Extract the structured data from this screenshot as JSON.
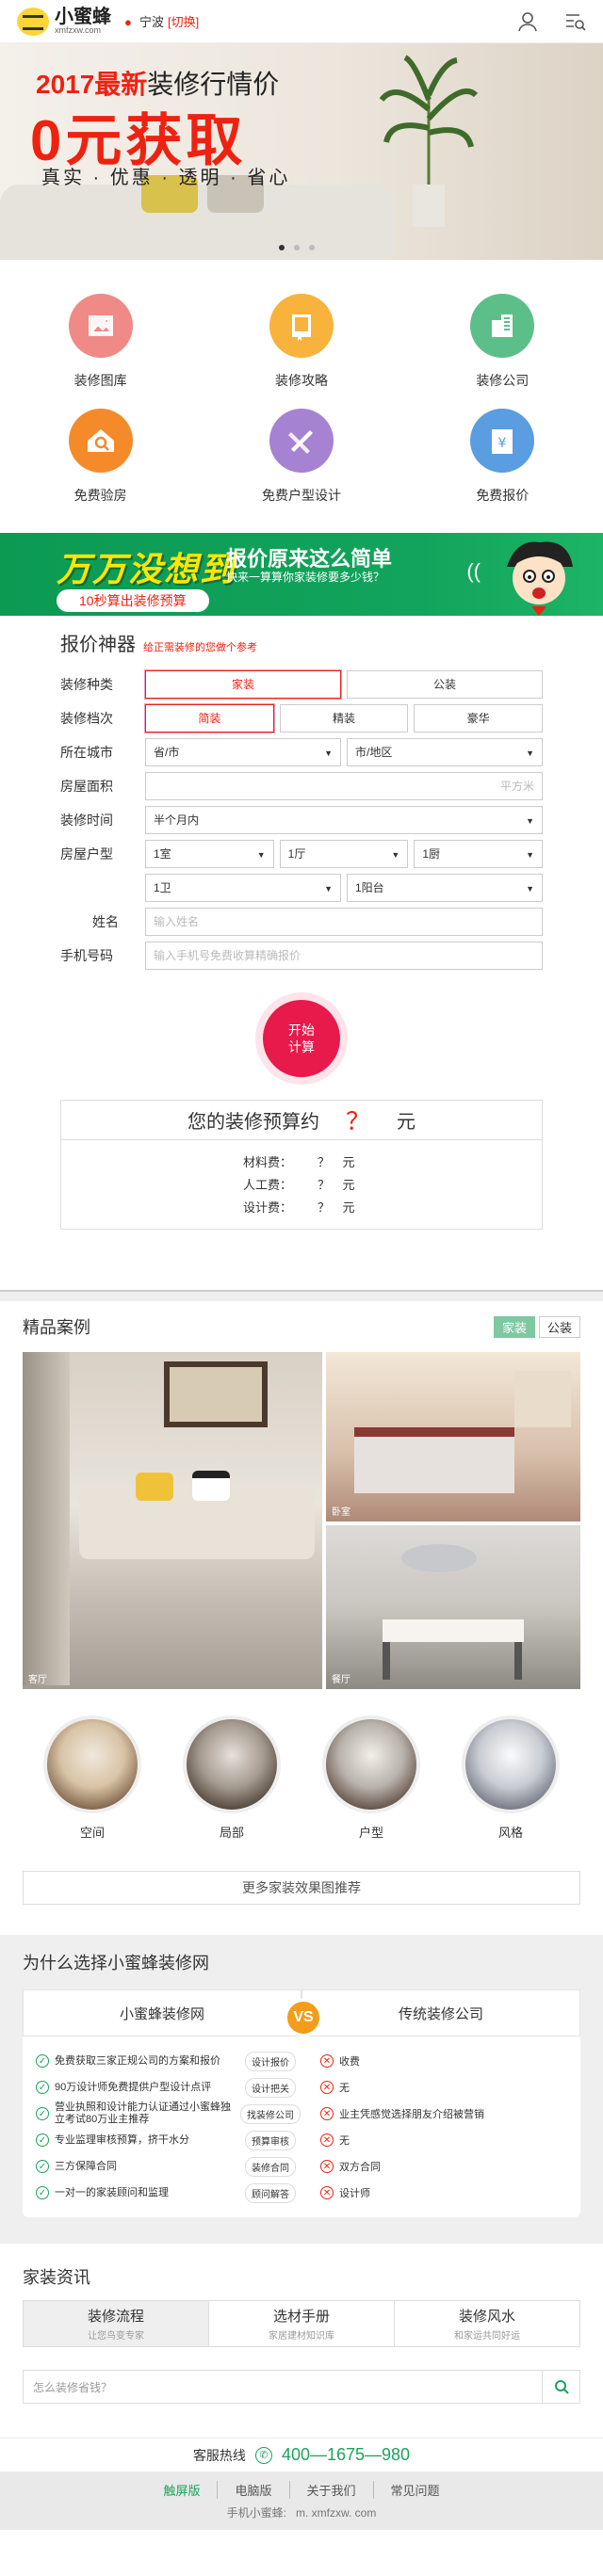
{
  "header": {
    "brand": "小蜜蜂",
    "domain": "xmfzxw.com",
    "city": "宁波",
    "city_switch": "[切换]"
  },
  "hero": {
    "line1_a": "2017最新",
    "line1_b": "装修行情价",
    "line2": "0元获取",
    "line3": "真实 · 优惠 · 透明 · 省心"
  },
  "features": [
    {
      "label": "装修图库",
      "color": "#f08a86",
      "icon": "picture-icon"
    },
    {
      "label": "装修攻略",
      "color": "#f7b33c",
      "icon": "book-icon"
    },
    {
      "label": "装修公司",
      "color": "#5cbf8a",
      "icon": "building-icon"
    },
    {
      "label": "免费验房",
      "color": "#f58a2a",
      "icon": "house-icon"
    },
    {
      "label": "免费户型设计",
      "color": "#a682d2",
      "icon": "design-icon"
    },
    {
      "label": "免费报价",
      "color": "#5a9de0",
      "icon": "price-icon"
    }
  ],
  "banner": {
    "big": "万万没想到",
    "title": "报价原来这么简单",
    "sub": "快来一算算你家装修要多少钱？",
    "pill": "10秒算出装修预算"
  },
  "calc": {
    "title": "报价神器",
    "subtitle": "给正需装修的您做个参考",
    "labels": {
      "type": "装修种类",
      "level": "装修档次",
      "city": "所在城市",
      "area": "房屋面积",
      "time": "装修时间",
      "layout": "房屋户型",
      "name": "姓名",
      "phone": "手机号码"
    },
    "type_opts": [
      "家装",
      "公装"
    ],
    "level_opts": [
      "简装",
      "精装",
      "豪华"
    ],
    "city_ph": "省/市",
    "district_ph": "市/地区",
    "area_unit": "平方米",
    "time_val": "半个月内",
    "room": "1室",
    "hall": "1厅",
    "kitchen": "1厨",
    "bath": "1卫",
    "balcony": "1阳台",
    "name_ph": "输入姓名",
    "phone_ph": "输入手机号免费收算精确报价",
    "go": "开始计算"
  },
  "result": {
    "title_a": "您的装修预算约",
    "q": "？",
    "unit": "元",
    "rows": [
      {
        "k": "材料费：",
        "v": "？",
        "u": "元"
      },
      {
        "k": "人工费：",
        "v": "？",
        "u": "元"
      },
      {
        "k": "设计费：",
        "v": "？",
        "u": "元"
      }
    ]
  },
  "cases": {
    "title": "精品案例",
    "tabs": [
      "家装",
      "公装"
    ],
    "imgs": [
      {
        "cap": "客厅"
      },
      {
        "cap": "卧室"
      },
      {
        "cap": "餐厅"
      }
    ],
    "circles": [
      "空间",
      "局部",
      "户型",
      "风格"
    ],
    "more": "更多家装效果图推荐"
  },
  "why": {
    "title": "为什么选择小蜜蜂装修网",
    "left": "小蜜蜂装修网",
    "right": "传统装修公司",
    "vs": "VS",
    "rows": [
      {
        "l": "免费获取三家正规公司的方案和报价",
        "m": "设计报价",
        "r": "收费"
      },
      {
        "l": "90万设计师免费提供户型设计点评",
        "m": "设计把关",
        "r": "无"
      },
      {
        "l": "营业执照和设计能力认证通过小蜜蜂独立考试80万业主推荐",
        "m": "找装修公司",
        "r": "业主凭感觉选择朋友介绍被营销"
      },
      {
        "l": "专业监理审核预算，挤干水分",
        "m": "预算审核",
        "r": "无"
      },
      {
        "l": "三方保障合同",
        "m": "装修合同",
        "r": "双方合同"
      },
      {
        "l": "一对一的家装顾问和监理",
        "m": "顾问解答",
        "r": "设计师"
      }
    ]
  },
  "news": {
    "title": "家装资讯",
    "tabs": [
      {
        "a": "装修流程",
        "b": "让您鸟变专家"
      },
      {
        "a": "选材手册",
        "b": "家居建材知识库"
      },
      {
        "a": "装修风水",
        "b": "和家运共同好运"
      }
    ],
    "search_ph": "怎么装修省钱？"
  },
  "footer": {
    "hotline_label": "客服热线",
    "hotline": "400—1675—980",
    "nav": [
      "触屏版",
      "电脑版",
      "关于我们",
      "常见问题"
    ],
    "site_label": "手机小蜜蜂:",
    "site": "m. xmfzxw. com"
  }
}
